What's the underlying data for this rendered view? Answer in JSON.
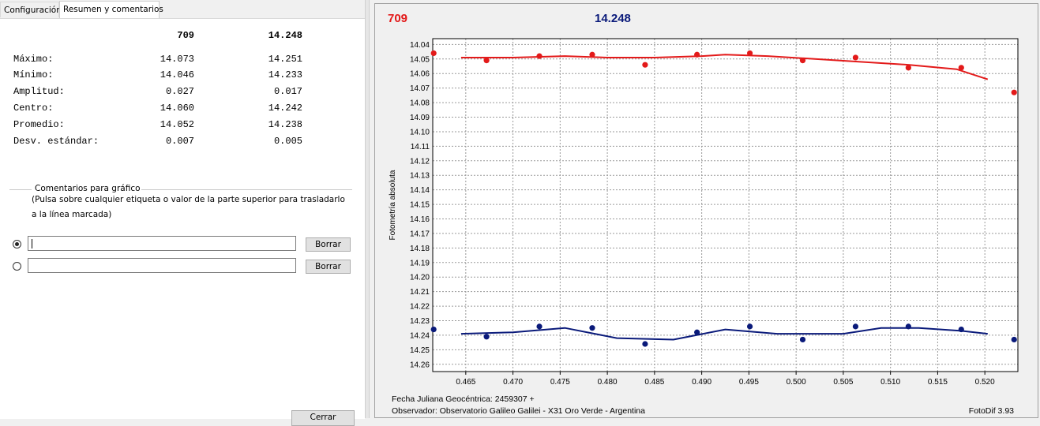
{
  "tabs": [
    {
      "label": "Configuración",
      "active": false
    },
    {
      "label": "Resumen y comentarios",
      "active": true
    }
  ],
  "summary": {
    "columns": [
      "709",
      "14.248"
    ],
    "rows": [
      {
        "label": "Máximo:",
        "values": [
          "14.073",
          "14.251"
        ]
      },
      {
        "label": "Mínimo:",
        "values": [
          "14.046",
          "14.233"
        ]
      },
      {
        "label": "Amplitud:",
        "values": [
          "0.027",
          "0.017"
        ]
      },
      {
        "label": "Centro:",
        "values": [
          "14.060",
          "14.242"
        ]
      },
      {
        "label": "Promedio:",
        "values": [
          "14.052",
          "14.238"
        ]
      },
      {
        "label": "Desv. estándar:",
        "values": [
          "0.007",
          "0.005"
        ]
      }
    ]
  },
  "comments": {
    "title": "Comentarios para gráfico",
    "hint_line1": "(Pulsa sobre cualquier etiqueta o valor de la parte superior para trasladarlo",
    "hint_line2": "a la línea marcada)",
    "field1_value": "",
    "field2_value": "",
    "clear_label": "Borrar",
    "selected_field": 1
  },
  "bottom_button_label": "Cerrar",
  "chart_panel": {
    "label_red": "709",
    "label_blue": "14.248",
    "footer_line1": "Fecha Juliana Geocéntrica: 2459307 +",
    "footer_line2": "Observador: Observatorio Galileo Galilei - X31 Oro Verde - Argentina",
    "version": "FotoDif 3.93"
  },
  "chart_data": {
    "type": "scatter",
    "ylabel": "Fotometría absoluta",
    "xlabel": "",
    "xlim": [
      0.4615,
      0.5235
    ],
    "ylim": [
      14.265,
      14.036
    ],
    "x_ticks": [
      "0.465",
      "0.470",
      "0.475",
      "0.480",
      "0.485",
      "0.490",
      "0.495",
      "0.500",
      "0.505",
      "0.510",
      "0.515",
      "0.520"
    ],
    "y_ticks": [
      "14.04",
      "14.05",
      "14.06",
      "14.07",
      "14.08",
      "14.09",
      "14.10",
      "14.11",
      "14.12",
      "14.13",
      "14.14",
      "14.15",
      "14.16",
      "14.17",
      "14.18",
      "14.19",
      "14.20",
      "14.21",
      "14.22",
      "14.23",
      "14.24",
      "14.25",
      "14.26"
    ],
    "grid": true,
    "series": [
      {
        "name": "709",
        "color": "#e31a1a",
        "x": [
          0.4616,
          0.4672,
          0.4728,
          0.4784,
          0.484,
          0.4895,
          0.4951,
          0.5007,
          0.5063,
          0.5119,
          0.5175,
          0.5231
        ],
        "y": [
          14.046,
          14.051,
          14.048,
          14.047,
          14.054,
          14.047,
          14.046,
          14.051,
          14.049,
          14.056,
          14.056,
          14.073
        ],
        "fit_x": [
          0.4645,
          0.47,
          0.4755,
          0.48,
          0.485,
          0.49,
          0.4925,
          0.497,
          0.502,
          0.507,
          0.512,
          0.517,
          0.5203
        ],
        "fit_y": [
          14.049,
          14.049,
          14.048,
          14.049,
          14.049,
          14.048,
          14.047,
          14.048,
          14.05,
          14.052,
          14.054,
          14.057,
          14.064
        ]
      },
      {
        "name": "14.248",
        "color": "#0a1a7a",
        "x": [
          0.4616,
          0.4672,
          0.4728,
          0.4784,
          0.484,
          0.4895,
          0.4951,
          0.5007,
          0.5063,
          0.5119,
          0.5175,
          0.5231
        ],
        "y": [
          14.236,
          14.241,
          14.234,
          14.235,
          14.246,
          14.238,
          14.234,
          14.243,
          14.234,
          14.234,
          14.236,
          14.243
        ],
        "fit_x": [
          0.4645,
          0.47,
          0.4755,
          0.481,
          0.487,
          0.4925,
          0.498,
          0.505,
          0.509,
          0.513,
          0.5175,
          0.5203
        ],
        "fit_y": [
          14.239,
          14.238,
          14.235,
          14.242,
          14.243,
          14.236,
          14.239,
          14.239,
          14.235,
          14.235,
          14.237,
          14.239
        ]
      }
    ]
  }
}
